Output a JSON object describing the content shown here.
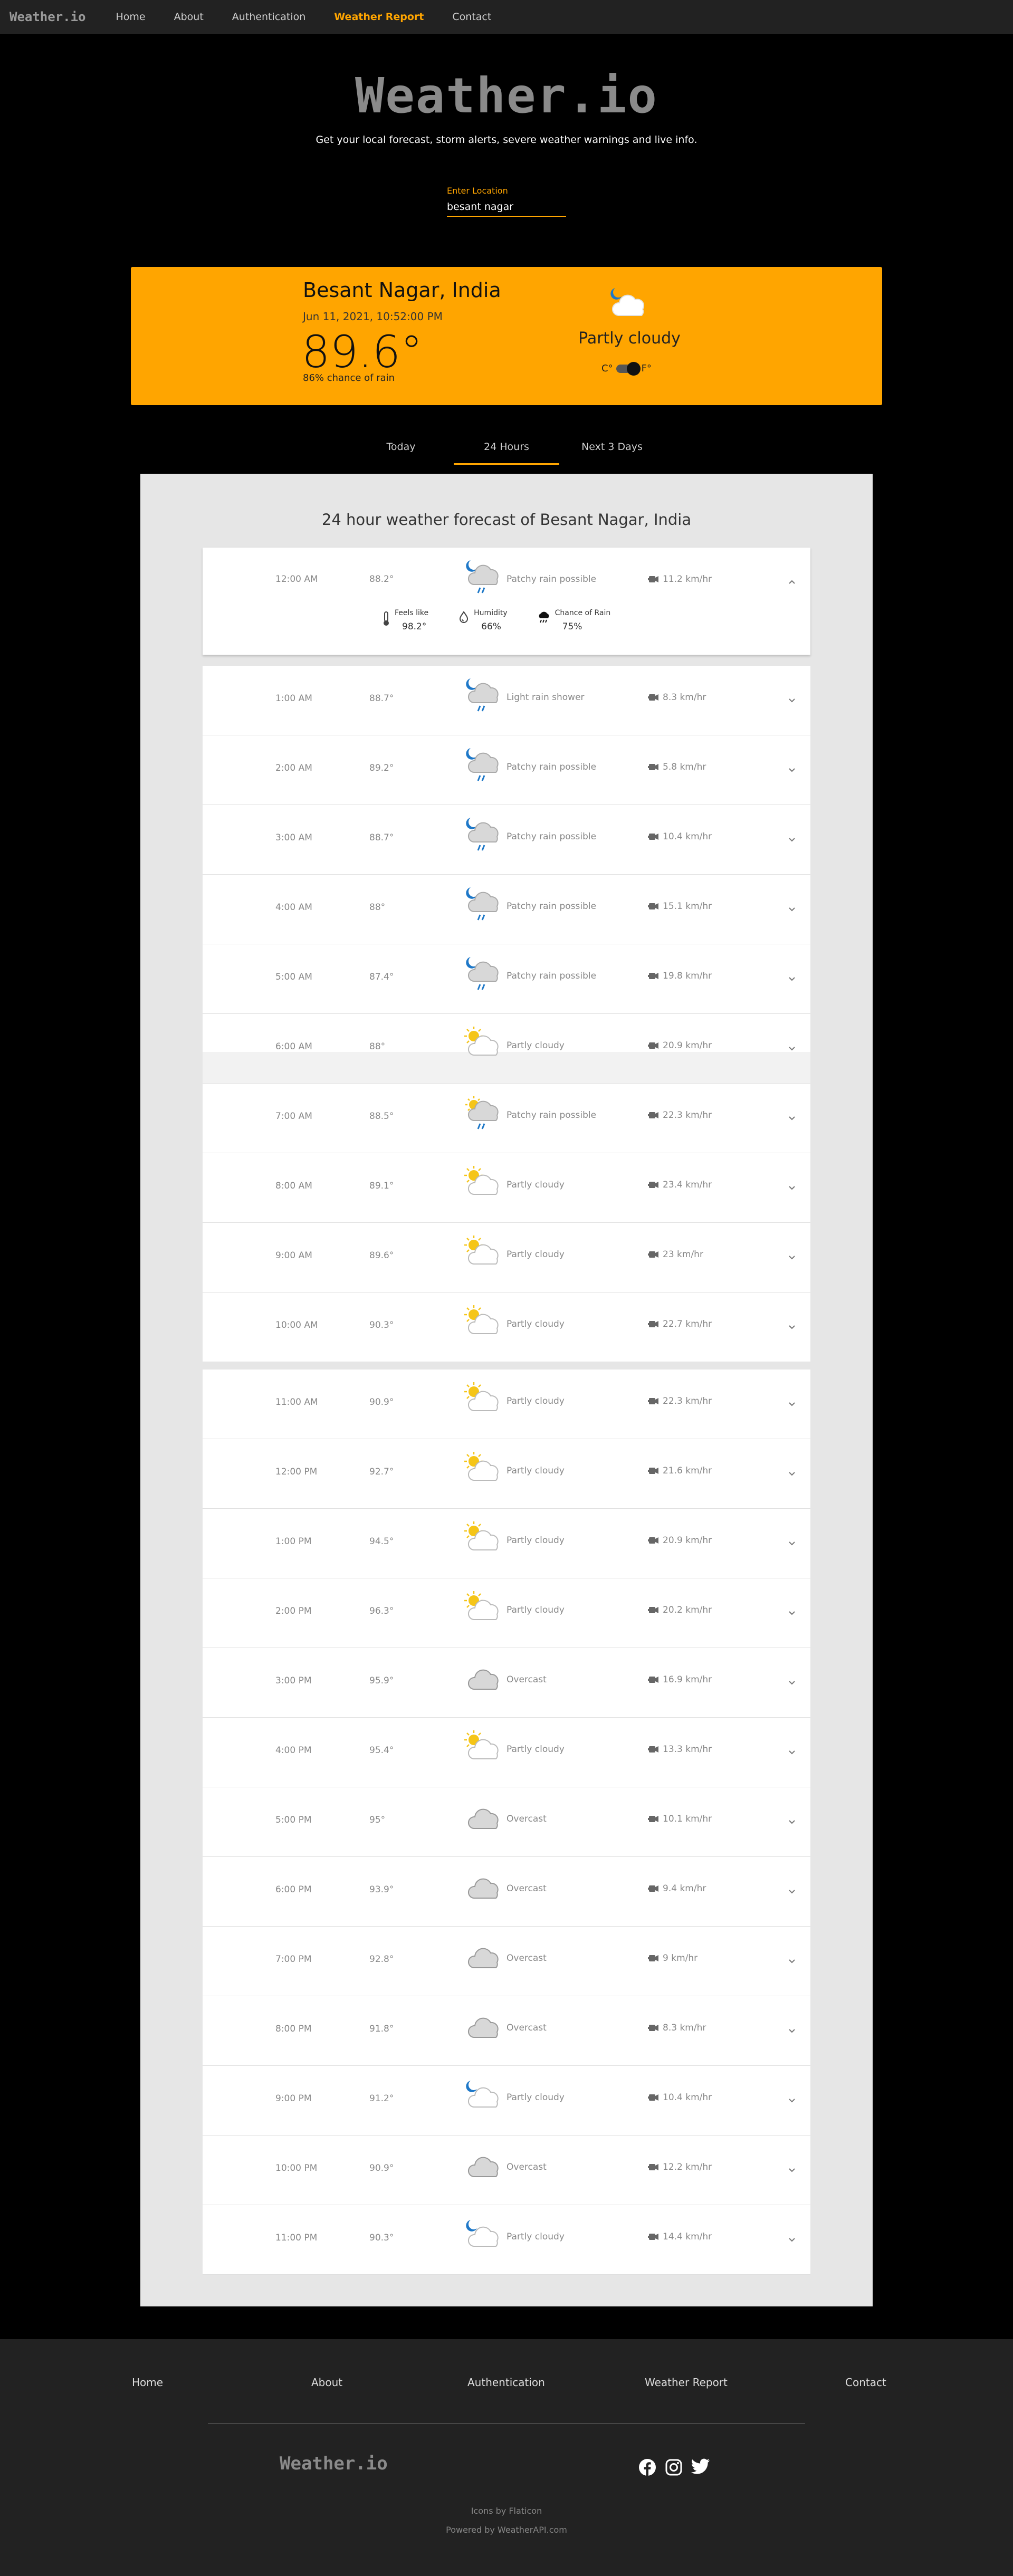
{
  "nav": {
    "logo": "Weather.io",
    "links": [
      "Home",
      "About",
      "Authentication",
      "Weather Report",
      "Contact"
    ],
    "active": "Weather Report"
  },
  "hero": {
    "title": "Weather.io",
    "subtitle": "Get your local forecast, storm alerts, severe weather warnings and live info."
  },
  "search": {
    "label": "Enter Location",
    "value": "besant nagar"
  },
  "current": {
    "city": "Besant Nagar, India",
    "datetime": "Jun 11, 2021, 10:52:00 PM",
    "temp": "89.6°",
    "rain": "86% chance of rain",
    "condition": "Partly cloudy",
    "icon": "moon-cloud-icon",
    "unit_c": "C°",
    "unit_f": "F°",
    "unit_selected": "F"
  },
  "tabs": {
    "items": [
      "Today",
      "24 Hours",
      "Next 3 Days"
    ],
    "active": "24 Hours"
  },
  "forecast": {
    "title": "24 hour weather forecast of Besant Nagar, India",
    "expanded": {
      "time": "12:00 AM",
      "temp": "88.2°",
      "condition": "Patchy rain possible",
      "icon": "moon-rain-icon",
      "wind": "11.2 km/hr",
      "feels_label": "Feels like",
      "feels": "98.2°",
      "humidity_label": "Humidity",
      "humidity": "66%",
      "rain_label": "Chance of Rain",
      "rain": "75%"
    },
    "rows": [
      {
        "time": "1:00 AM",
        "temp": "88.7°",
        "condition": "Light rain shower",
        "icon": "moon-rain-icon",
        "wind": "8.3 km/hr"
      },
      {
        "time": "2:00 AM",
        "temp": "89.2°",
        "condition": "Patchy rain possible",
        "icon": "moon-rain-icon",
        "wind": "5.8 km/hr"
      },
      {
        "time": "3:00 AM",
        "temp": "88.7°",
        "condition": "Patchy rain possible",
        "icon": "moon-rain-icon",
        "wind": "10.4 km/hr"
      },
      {
        "time": "4:00 AM",
        "temp": "88°",
        "condition": "Patchy rain possible",
        "icon": "moon-rain-icon",
        "wind": "15.1 km/hr"
      },
      {
        "time": "5:00 AM",
        "temp": "87.4°",
        "condition": "Patchy rain possible",
        "icon": "moon-rain-icon",
        "wind": "19.8 km/hr"
      },
      {
        "time": "6:00 AM",
        "temp": "88°",
        "condition": "Partly cloudy",
        "icon": "sun-cloud-icon",
        "wind": "20.9 km/hr"
      },
      {
        "time": "7:00 AM",
        "temp": "88.5°",
        "condition": "Patchy rain possible",
        "icon": "sun-rain-icon",
        "wind": "22.3 km/hr"
      },
      {
        "time": "8:00 AM",
        "temp": "89.1°",
        "condition": "Partly cloudy",
        "icon": "sun-cloud-icon",
        "wind": "23.4 km/hr"
      },
      {
        "time": "9:00 AM",
        "temp": "89.6°",
        "condition": "Partly cloudy",
        "icon": "sun-cloud-icon",
        "wind": "23 km/hr"
      },
      {
        "time": "10:00 AM",
        "temp": "90.3°",
        "condition": "Partly cloudy",
        "icon": "sun-cloud-icon",
        "wind": "22.7 km/hr"
      },
      {
        "time": "11:00 AM",
        "temp": "90.9°",
        "condition": "Partly cloudy",
        "icon": "sun-cloud-icon",
        "wind": "22.3 km/hr"
      },
      {
        "time": "12:00 PM",
        "temp": "92.7°",
        "condition": "Partly cloudy",
        "icon": "sun-cloud-icon",
        "wind": "21.6 km/hr"
      },
      {
        "time": "1:00 PM",
        "temp": "94.5°",
        "condition": "Partly cloudy",
        "icon": "sun-cloud-icon",
        "wind": "20.9 km/hr"
      },
      {
        "time": "2:00 PM",
        "temp": "96.3°",
        "condition": "Partly cloudy",
        "icon": "sun-cloud-icon",
        "wind": "20.2 km/hr"
      },
      {
        "time": "3:00 PM",
        "temp": "95.9°",
        "condition": "Overcast",
        "icon": "cloud-icon",
        "wind": "16.9 km/hr"
      },
      {
        "time": "4:00 PM",
        "temp": "95.4°",
        "condition": "Partly cloudy",
        "icon": "sun-cloud-icon",
        "wind": "13.3 km/hr"
      },
      {
        "time": "5:00 PM",
        "temp": "95°",
        "condition": "Overcast",
        "icon": "cloud-icon",
        "wind": "10.1 km/hr"
      },
      {
        "time": "6:00 PM",
        "temp": "93.9°",
        "condition": "Overcast",
        "icon": "cloud-icon",
        "wind": "9.4 km/hr"
      },
      {
        "time": "7:00 PM",
        "temp": "92.8°",
        "condition": "Overcast",
        "icon": "cloud-icon",
        "wind": "9 km/hr"
      },
      {
        "time": "8:00 PM",
        "temp": "91.8°",
        "condition": "Overcast",
        "icon": "cloud-icon",
        "wind": "8.3 km/hr"
      },
      {
        "time": "9:00 PM",
        "temp": "91.2°",
        "condition": "Partly cloudy",
        "icon": "moon-cloud-icon",
        "wind": "10.4 km/hr"
      },
      {
        "time": "10:00 PM",
        "temp": "90.9°",
        "condition": "Overcast",
        "icon": "cloud-icon",
        "wind": "12.2 km/hr"
      },
      {
        "time": "11:00 PM",
        "temp": "90.3°",
        "condition": "Partly cloudy",
        "icon": "moon-cloud-icon",
        "wind": "14.4 km/hr"
      }
    ]
  },
  "footer": {
    "links": [
      "Home",
      "About",
      "Authentication",
      "Weather Report",
      "Contact"
    ],
    "logo": "Weather.io",
    "social": [
      "facebook-icon",
      "instagram-icon",
      "twitter-icon"
    ],
    "credit": "Icons by Flaticon",
    "powered": "Powered by WeatherAPI.com"
  },
  "colors": {
    "accent": "#ffa500",
    "nav_bg": "#222222",
    "page_bg": "#000000",
    "panel_bg": "#e6e6e6",
    "moon_blue": "#1e78c8",
    "sun_yellow": "#f5c518"
  }
}
